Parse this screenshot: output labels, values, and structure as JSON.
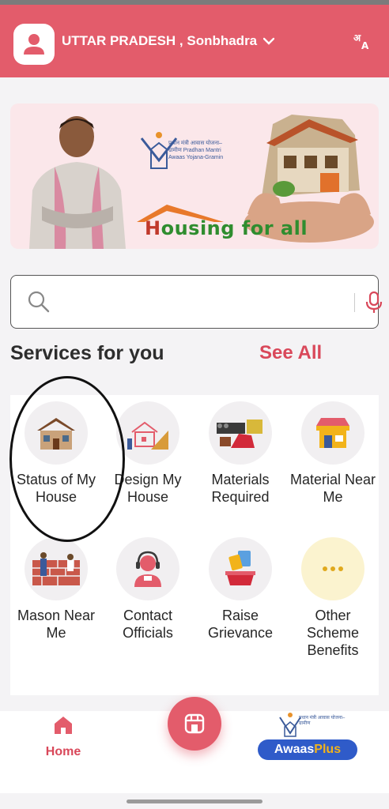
{
  "header": {
    "location": "UTTAR PRADESH , Sonbhadra",
    "language_icon": "translate-icon",
    "avatar_icon": "user-icon"
  },
  "banner": {
    "tagline_first": "H",
    "tagline_rest": "ousing for all",
    "logo_text": "प्रधान मंत्री आवास योजना–ग्रामीण Pradhan Mantri Awaas Yojana-Gramin"
  },
  "search": {
    "placeholder": ""
  },
  "services": {
    "title": "Services for you",
    "see_all": "See All",
    "items": [
      {
        "label": "Status of My House",
        "icon": "house-icon"
      },
      {
        "label": "Design My House",
        "icon": "blueprint-icon"
      },
      {
        "label": "Materials Required",
        "icon": "materials-icon"
      },
      {
        "label": "Material Near Me",
        "icon": "shop-icon"
      },
      {
        "label": "Mason Near Me",
        "icon": "mason-icon"
      },
      {
        "label": "Contact Officials",
        "icon": "support-agent-icon"
      },
      {
        "label": "Raise Grievance",
        "icon": "grievance-icon"
      },
      {
        "label": "Other Scheme Benefits",
        "icon": "more-icon"
      }
    ]
  },
  "bottom_nav": {
    "home_label": "Home",
    "awaas_main": "Awaas",
    "awaas_plus": "Plus",
    "awaas_logo_text": "प्रधान मंत्री आवास योजना–ग्रामीण"
  },
  "colors": {
    "brand": "#e35c6b",
    "accent_text": "#d9485a",
    "awaas_blue": "#2f5bc9",
    "awaas_yellow": "#f2b31a"
  }
}
